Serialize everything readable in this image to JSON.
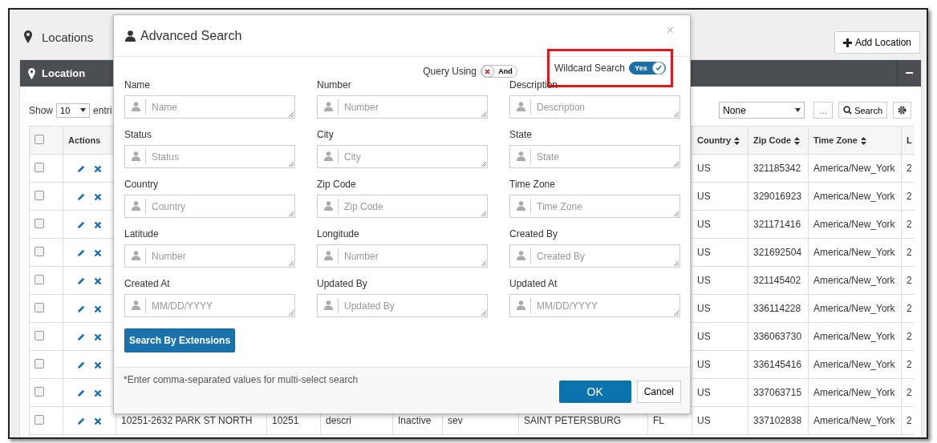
{
  "page": {
    "title": "Locations",
    "add_button": "Add Location"
  },
  "card": {
    "title": "Location",
    "collapse": "−"
  },
  "toolbar": {
    "show_label": "Show",
    "page_size": "10",
    "entries_label": "entri",
    "filter": "None",
    "more_button": "...",
    "search_button": "Search"
  },
  "table": {
    "select_all_checked": false,
    "actions_header": "Actions",
    "columns": [
      {},
      {},
      {},
      {},
      {},
      {},
      {},
      {
        "label": "Country",
        "sortable": true
      },
      {
        "label": "Zip Code",
        "sortable": true
      },
      {
        "label": "Time Zone",
        "sortable": true
      },
      {
        "label": "L"
      }
    ],
    "rows": [
      {
        "checked": false,
        "cells": [
          "",
          "",
          "",
          "",
          "",
          "",
          "",
          "US",
          "321185342",
          "America/New_York",
          "2"
        ]
      },
      {
        "checked": false,
        "cells": [
          "",
          "",
          "",
          "",
          "",
          "",
          "",
          "US",
          "329016923",
          "America/New_York",
          "2"
        ]
      },
      {
        "checked": false,
        "cells": [
          "",
          "",
          "",
          "",
          "",
          "",
          "",
          "US",
          "321171416",
          "America/New_York",
          "2"
        ]
      },
      {
        "checked": false,
        "cells": [
          "",
          "",
          "",
          "",
          "",
          "",
          "",
          "US",
          "321692504",
          "America/New_York",
          "2"
        ]
      },
      {
        "checked": false,
        "cells": [
          "",
          "",
          "",
          "",
          "",
          "",
          "",
          "US",
          "321145402",
          "America/New_York",
          "2"
        ]
      },
      {
        "checked": false,
        "cells": [
          "",
          "",
          "",
          "",
          "",
          "",
          "",
          "US",
          "336114228",
          "America/New_York",
          "2"
        ]
      },
      {
        "checked": false,
        "cells": [
          "",
          "",
          "",
          "",
          "",
          "",
          "",
          "US",
          "336063730",
          "America/New_York",
          "2"
        ]
      },
      {
        "checked": false,
        "cells": [
          "",
          "",
          "",
          "",
          "",
          "",
          "",
          "US",
          "336145416",
          "America/New_York",
          "2"
        ]
      },
      {
        "checked": false,
        "cells": [
          "",
          "",
          "",
          "",
          "",
          "",
          "",
          "US",
          "337063715",
          "America/New_York",
          "2"
        ]
      },
      {
        "checked": false,
        "cells": [
          "10251-2632 PARK ST NORTH",
          "10251",
          "descri",
          "Inactive",
          "sev",
          "SAINT PETERSBURG",
          "FL",
          "US",
          "337102838",
          "America/New_York",
          "2"
        ]
      }
    ]
  },
  "modal": {
    "title": "Advanced Search",
    "close": "×",
    "toggles": [
      {
        "label": "Query Using",
        "on": false,
        "text": "And",
        "highlighted": false
      },
      {
        "label": "Wildcard Search",
        "on": true,
        "text": "Yes",
        "highlighted": true
      }
    ],
    "fields": [
      {
        "label": "Name",
        "placeholder": "Name"
      },
      {
        "label": "Number",
        "placeholder": "Number"
      },
      {
        "label": "Description",
        "placeholder": "Description"
      },
      {
        "label": "Status",
        "placeholder": "Status"
      },
      {
        "label": "City",
        "placeholder": "City"
      },
      {
        "label": "State",
        "placeholder": "State"
      },
      {
        "label": "Country",
        "placeholder": "Country"
      },
      {
        "label": "Zip Code",
        "placeholder": "Zip Code"
      },
      {
        "label": "Time Zone",
        "placeholder": "Time Zone"
      },
      {
        "label": "Latitude",
        "placeholder": "Number"
      },
      {
        "label": "Longitude",
        "placeholder": "Number"
      },
      {
        "label": "Created By",
        "placeholder": "Created By"
      },
      {
        "label": "Created At",
        "placeholder": "MM/DD/YYYY"
      },
      {
        "label": "Updated By",
        "placeholder": "Updated By"
      },
      {
        "label": "Updated At",
        "placeholder": "MM/DD/YYYY"
      }
    ],
    "extensions_button": "Search By Extensions",
    "note": "*Enter comma-separated values for multi-select search",
    "ok": "OK",
    "cancel": "Cancel"
  }
}
